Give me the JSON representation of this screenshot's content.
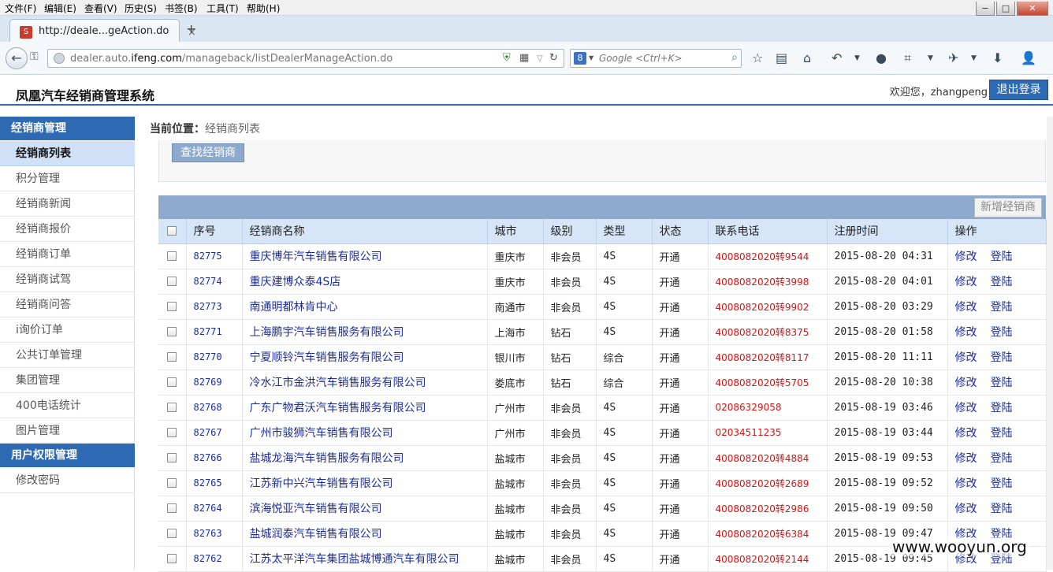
{
  "browser": {
    "menu": [
      "文件(F)",
      "编辑(E)",
      "查看(V)",
      "历史(S)",
      "书签(B)",
      "工具(T)",
      "帮助(H)"
    ],
    "tab_title": "http://deale...geAction.do",
    "tab_close": "×",
    "new_tab": "+",
    "url_host": "dealer.auto.",
    "url_bold": "ifeng.com",
    "url_path": "/manageback/listDealerManageAction.do",
    "search_placeholder": "Google <Ctrl+K>",
    "search_engine_letter": "8",
    "window_buttons": [
      "−",
      "□",
      "✕"
    ]
  },
  "app": {
    "title": "凤凰汽车经销商管理系统",
    "welcome": "欢迎您，zhangpeng",
    "logout": "退出登录"
  },
  "sidebar": {
    "sections": [
      {
        "label": "经销商管理"
      },
      {
        "label": "用户权限管理"
      }
    ],
    "items": [
      {
        "label": "经销商列表",
        "active": true
      },
      {
        "label": "积分管理"
      },
      {
        "label": "经销商新闻"
      },
      {
        "label": "经销商报价"
      },
      {
        "label": "经销商订单"
      },
      {
        "label": "经销商试驾"
      },
      {
        "label": "经销商问答"
      },
      {
        "label": "i询价订单"
      },
      {
        "label": "公共订单管理"
      },
      {
        "label": "集团管理"
      },
      {
        "label": "400电话统计"
      },
      {
        "label": "图片管理"
      },
      {
        "label": "修改密码"
      }
    ]
  },
  "breadcrumb": {
    "prefix": "当前位置：",
    "current": "经销商列表"
  },
  "search_panel": {
    "find_button": "查找经销商"
  },
  "grid": {
    "add_button": "新增经销商",
    "columns": [
      "序号",
      "经销商名称",
      "城市",
      "级别",
      "类型",
      "状态",
      "联系电话",
      "注册时间",
      "操作"
    ],
    "actions": [
      "修改",
      "登陆"
    ],
    "rows": [
      {
        "id": "82775",
        "name": "重庆博年汽车销售有限公司",
        "city": "重庆市",
        "level": "非会员",
        "type": "4S",
        "status": "开通",
        "phone": "4008082020转9544",
        "time": "2015-08-20 04:31"
      },
      {
        "id": "82774",
        "name": "重庆建博众泰4S店",
        "city": "重庆市",
        "level": "非会员",
        "type": "4S",
        "status": "开通",
        "phone": "4008082020转3998",
        "time": "2015-08-20 04:01"
      },
      {
        "id": "82773",
        "name": "南通明都林肯中心",
        "city": "南通市",
        "level": "非会员",
        "type": "4S",
        "status": "开通",
        "phone": "4008082020转9902",
        "time": "2015-08-20 03:29"
      },
      {
        "id": "82771",
        "name": "上海鹏宇汽车销售服务有限公司",
        "city": "上海市",
        "level": "钻石",
        "type": "4S",
        "status": "开通",
        "phone": "4008082020转8375",
        "time": "2015-08-20 01:58"
      },
      {
        "id": "82770",
        "name": "宁夏顺铃汽车销售服务有限公司",
        "city": "银川市",
        "level": "钻石",
        "type": "综合",
        "status": "开通",
        "phone": "4008082020转8117",
        "time": "2015-08-20 11:11"
      },
      {
        "id": "82769",
        "name": "冷水江市金洪汽车销售服务有限公司",
        "city": "娄底市",
        "level": "钻石",
        "type": "综合",
        "status": "开通",
        "phone": "4008082020转5705",
        "time": "2015-08-20 10:38"
      },
      {
        "id": "82768",
        "name": "广东广物君沃汽车销售服务有限公司",
        "city": "广州市",
        "level": "非会员",
        "type": "4S",
        "status": "开通",
        "phone": "02086329058",
        "time": "2015-08-19 03:46"
      },
      {
        "id": "82767",
        "name": "广州市骏狮汽车销售有限公司",
        "city": "广州市",
        "level": "非会员",
        "type": "4S",
        "status": "开通",
        "phone": "02034511235",
        "time": "2015-08-19 03:44"
      },
      {
        "id": "82766",
        "name": "盐城龙海汽车销售服务有限公司",
        "city": "盐城市",
        "level": "非会员",
        "type": "4S",
        "status": "开通",
        "phone": "4008082020转4884",
        "time": "2015-08-19 09:53"
      },
      {
        "id": "82765",
        "name": "江苏新中兴汽车销售有限公司",
        "city": "盐城市",
        "level": "非会员",
        "type": "4S",
        "status": "开通",
        "phone": "4008082020转2689",
        "time": "2015-08-19 09:52"
      },
      {
        "id": "82764",
        "name": "滨海悦亚汽车销售有限公司",
        "city": "盐城市",
        "level": "非会员",
        "type": "4S",
        "status": "开通",
        "phone": "4008082020转2986",
        "time": "2015-08-19 09:50"
      },
      {
        "id": "82763",
        "name": "盐城润泰汽车销售有限公司",
        "city": "盐城市",
        "level": "非会员",
        "type": "4S",
        "status": "开通",
        "phone": "4008082020转6384",
        "time": "2015-08-19 09:47"
      },
      {
        "id": "82762",
        "name": "江苏太平洋汽车集团盐城博通汽车有限公司",
        "city": "盐城市",
        "level": "非会员",
        "type": "4S",
        "status": "开通",
        "phone": "4008082020转2144",
        "time": "2015-08-19 09:45"
      }
    ]
  },
  "watermark": "www.wooyun.org",
  "colors": {
    "accent": "#2e69b3",
    "grid_header": "#d6e5f7",
    "link": "#1c2c9e",
    "phone": "#dd1111"
  }
}
